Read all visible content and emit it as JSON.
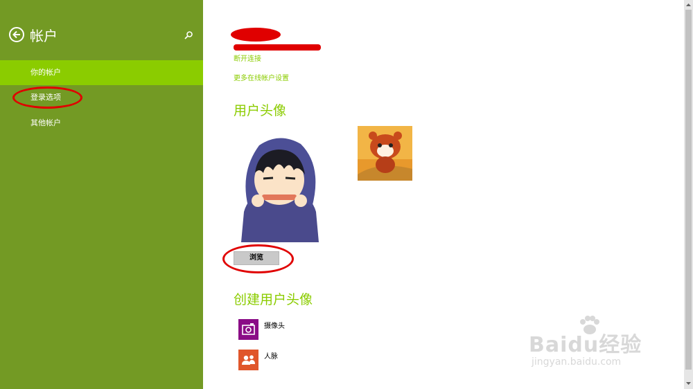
{
  "header": {
    "title": "帐户"
  },
  "nav": {
    "items": [
      {
        "label": "你的帐户",
        "active": true
      },
      {
        "label": "登录选项",
        "active": false
      },
      {
        "label": "其他帐户",
        "active": false
      }
    ]
  },
  "account": {
    "disconnect_link": "断开连接",
    "more_settings_link": "更多在线帐户设置"
  },
  "avatar_section": {
    "title": "用户头像",
    "browse_button": "浏览"
  },
  "create_section": {
    "title": "创建用户头像",
    "apps": [
      {
        "label": "摄像头",
        "icon": "camera-icon",
        "color": "#8a0c86"
      },
      {
        "label": "人脉",
        "icon": "people-icon",
        "color": "#e0562b"
      }
    ]
  },
  "watermark": {
    "brand": "Baidu经验",
    "url": "jingyan.baidu.com"
  },
  "colors": {
    "sidebar": "#739a24",
    "sidebar_active": "#8bcc00",
    "accent": "#8bcc00",
    "annotation": "#e00000"
  }
}
